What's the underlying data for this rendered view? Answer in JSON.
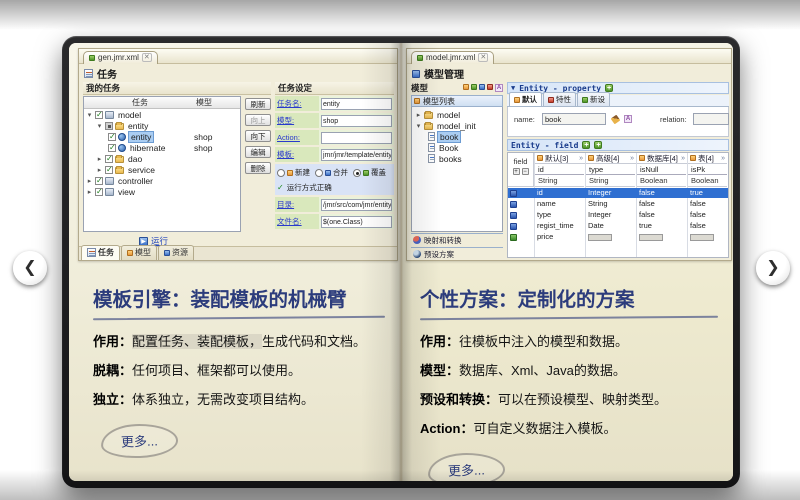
{
  "nav": {
    "prev_glyph": "❮",
    "next_glyph": "❯"
  },
  "colors": {
    "selection": "#2f6fd1",
    "label_green": "#d9e8bc",
    "radio_strip": "#d9e3f6",
    "heading": "#2c3c7c"
  },
  "left_page": {
    "editor": {
      "tab": "gen.jmr.xml",
      "close_glyph": "✕",
      "title": "任务",
      "tasks": {
        "header": "我的任务",
        "columns": [
          "任务",
          "模型"
        ],
        "tree": [
          {
            "label": "model",
            "model": ""
          },
          {
            "label": "entity",
            "model": ""
          },
          {
            "label": "entity",
            "model": "shop"
          },
          {
            "label": "hibernate",
            "model": "shop"
          },
          {
            "label": "dao",
            "model": ""
          },
          {
            "label": "service",
            "model": ""
          },
          {
            "label": "controller",
            "model": ""
          },
          {
            "label": "view",
            "model": ""
          }
        ],
        "buttons": [
          "刷新",
          "向上",
          "向下",
          "编辑",
          "删除"
        ],
        "run_label": "运行",
        "bottom_tabs": [
          "任务",
          "模型",
          "资源"
        ]
      },
      "settings": {
        "header": "任务设定",
        "rows": [
          {
            "label": "任务名:",
            "value": "entity"
          },
          {
            "label": "模型:",
            "value": "shop"
          },
          {
            "label": "Action:",
            "value": ""
          },
          {
            "label": "模板:",
            "value": "jmr/jmr/template/entity.java.jsl"
          }
        ],
        "radios": [
          "新建",
          "合并",
          "覆盖"
        ],
        "status": "运行方式正确",
        "rows2": [
          {
            "label": "目录:",
            "value": "/jmr/src/com/jmr/entity"
          },
          {
            "label": "文件名:",
            "value": "$(one.Class)"
          }
        ]
      }
    },
    "article": {
      "title": "模板引擎：装配模板的机械臂",
      "lines": [
        {
          "label": "作用：",
          "highlight": "配置任务、装配模板，",
          "text": "生成代码和文档。"
        },
        {
          "label": "脱耦：",
          "highlight": "",
          "text": "任何项目、框架都可以使用。"
        },
        {
          "label": "独立：",
          "highlight": "",
          "text": "体系独立，无需改变项目结构。"
        }
      ],
      "more": "更多..."
    }
  },
  "right_page": {
    "editor": {
      "tab": "model.jmr.xml",
      "close_glyph": "✕",
      "title": "模型管理",
      "model_panel": {
        "header": "模型",
        "list_header": "模型列表",
        "tree": [
          "model",
          "model_init",
          "book",
          "Book",
          "books"
        ],
        "bottom_items": [
          "映射和转换",
          "预设方案"
        ]
      },
      "property": {
        "header": "Entity - property",
        "tabs": [
          "默认",
          "特性",
          "新设"
        ],
        "name_label": "name:",
        "name_value": "book",
        "relation_label": "relation:",
        "relation_value": ""
      },
      "field": {
        "header": "Entity - field",
        "corner": "field",
        "groups": [
          "默认[3]",
          "高级[4]",
          "数据库[4]",
          "表[4]"
        ],
        "columns": [
          {
            "name": "id",
            "type": "String"
          },
          {
            "name": "type",
            "type": "String"
          },
          {
            "name": "isNull",
            "type": "Boolean"
          },
          {
            "name": "isPk",
            "type": "Boolean"
          }
        ],
        "rows": [
          {
            "name": "id",
            "cells": [
              "Integer",
              "false",
              "true"
            ]
          },
          {
            "name": "name",
            "cells": [
              "String",
              "false",
              "false"
            ]
          },
          {
            "name": "type",
            "cells": [
              "Integer",
              "false",
              "false"
            ]
          },
          {
            "name": "regist_time",
            "cells": [
              "Date",
              "true",
              "false"
            ]
          },
          {
            "name": "price",
            "cells": [
              "",
              "",
              ""
            ]
          }
        ]
      }
    },
    "article": {
      "title": "个性方案：定制化的方案",
      "lines": [
        {
          "label": "作用：",
          "text": "往模板中注入的模型和数据。"
        },
        {
          "label": "模型：",
          "text": "数据库、Xml、Java的数据。"
        },
        {
          "label": "预设和转换：",
          "text": "可以在预设模型、映射类型。"
        },
        {
          "label": "Action：",
          "text": "可自定义数据注入模板。"
        }
      ],
      "more": "更多..."
    }
  }
}
